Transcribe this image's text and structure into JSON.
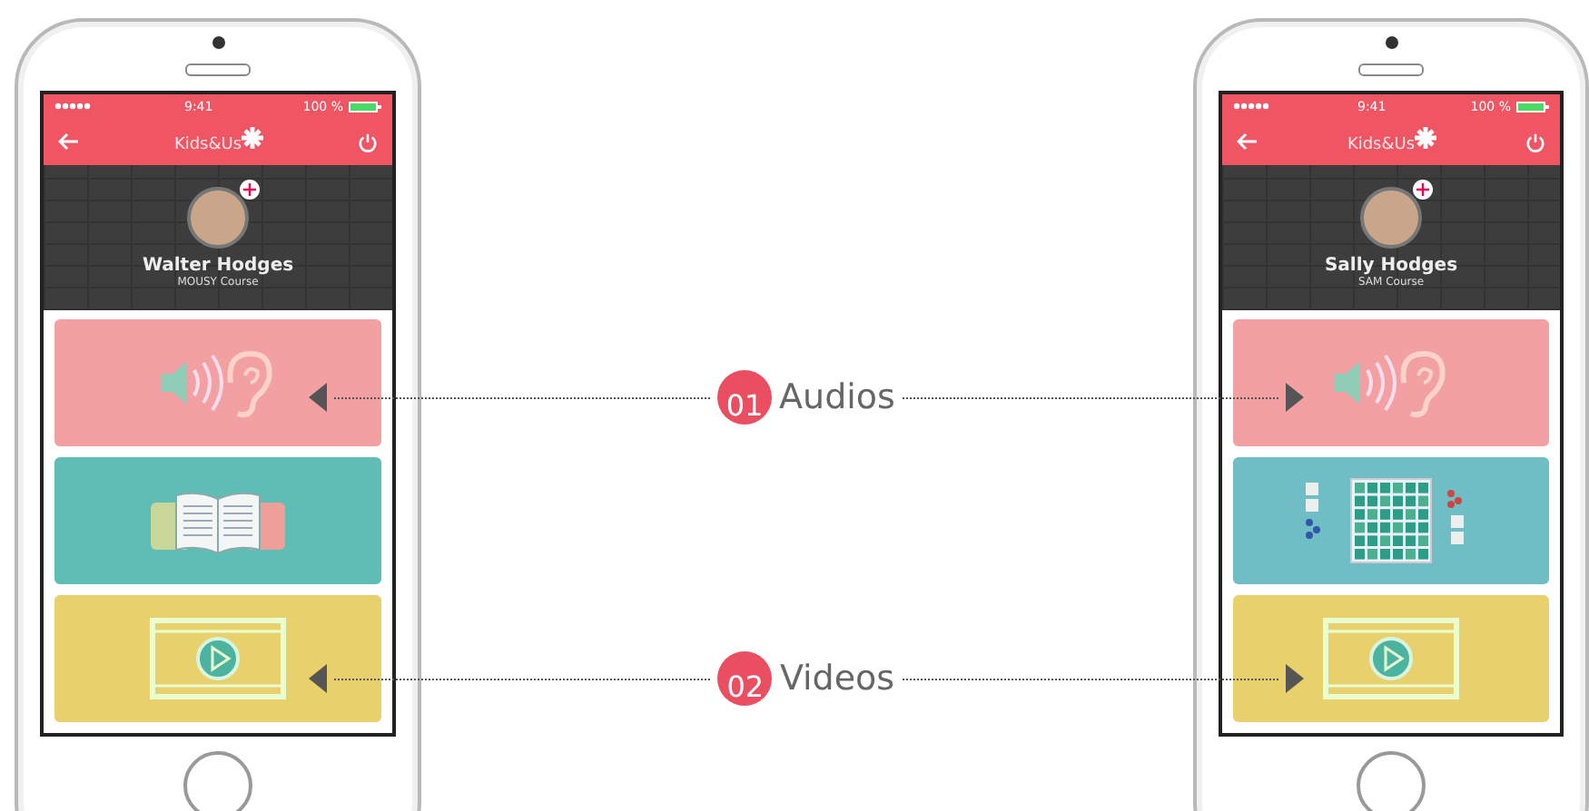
{
  "phones": [
    {
      "status": {
        "time": "9:41",
        "battery": "100 %"
      },
      "logo": "Kids&Us",
      "profile": {
        "name": "Walter Hodges",
        "course": "MOUSY Course"
      },
      "tiles": [
        {
          "kind": "audio"
        },
        {
          "kind": "books"
        },
        {
          "kind": "video"
        }
      ]
    },
    {
      "status": {
        "time": "9:41",
        "battery": "100 %"
      },
      "logo": "Kids&Us",
      "profile": {
        "name": "Sally Hodges",
        "course": "SAM Course"
      },
      "tiles": [
        {
          "kind": "audio"
        },
        {
          "kind": "game"
        },
        {
          "kind": "video"
        }
      ]
    }
  ],
  "callouts": [
    {
      "number": "01",
      "label": "Audios"
    },
    {
      "number": "02",
      "label": "Videos"
    }
  ]
}
